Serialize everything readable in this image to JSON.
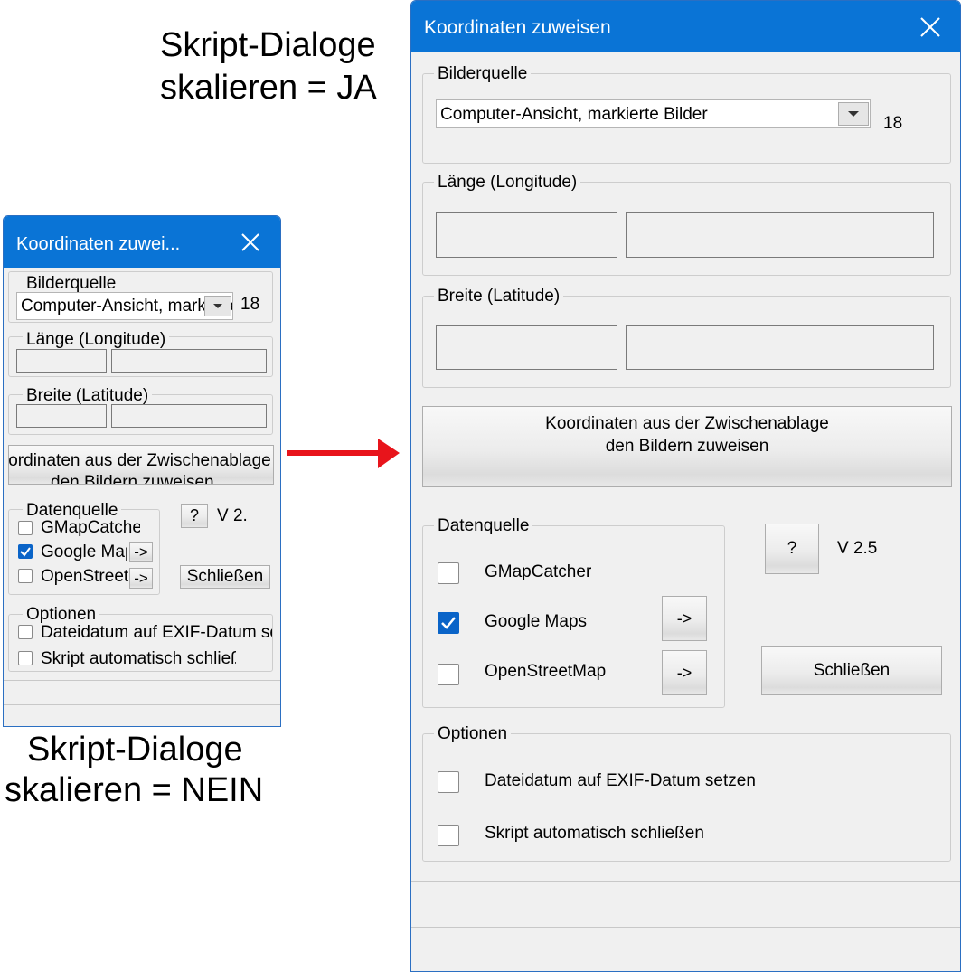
{
  "captions": {
    "yes_line1": "Skript-Dialoge",
    "yes_line2": "skalieren = JA",
    "no_line1": "Skript-Dialoge",
    "no_line2": "skalieren = NEIN"
  },
  "small_dialog": {
    "title": "Koordinaten zuwei...",
    "bilderquelle": {
      "legend": "Bilderquelle",
      "combo_value": "Computer-Ansicht, markierte Bilder",
      "count": "18"
    },
    "laenge": {
      "legend": "Länge (Longitude)"
    },
    "breite": {
      "legend": "Breite (Latitude)"
    },
    "assign_button": {
      "line1": "Koordinaten aus der Zwischenablage",
      "line2": "den Bildern zuweisen"
    },
    "datenquelle": {
      "legend": "Datenquelle",
      "items": [
        {
          "label": "GMapCatcher",
          "checked": false
        },
        {
          "label": "Google Maps",
          "checked": true,
          "arrow": "->"
        },
        {
          "label": "OpenStreetMap",
          "checked": false,
          "arrow": "->"
        }
      ]
    },
    "help_button": "?",
    "version": "V 2.",
    "close_button": "Schließen",
    "optionen": {
      "legend": "Optionen",
      "items": [
        {
          "label": "Dateidatum auf EXIF-Datum setzen",
          "checked": false
        },
        {
          "label": "Skript automatisch schließen",
          "checked": false
        }
      ]
    }
  },
  "large_dialog": {
    "title": "Koordinaten zuweisen",
    "bilderquelle": {
      "legend": "Bilderquelle",
      "combo_value": "Computer-Ansicht, markierte Bilder",
      "count": "18"
    },
    "laenge": {
      "legend": "Länge (Longitude)"
    },
    "breite": {
      "legend": "Breite (Latitude)"
    },
    "assign_button": {
      "line1": "Koordinaten aus der Zwischenablage",
      "line2": "den Bildern zuweisen"
    },
    "datenquelle": {
      "legend": "Datenquelle",
      "items": [
        {
          "label": "GMapCatcher",
          "checked": false
        },
        {
          "label": "Google Maps",
          "checked": true,
          "arrow": "->"
        },
        {
          "label": "OpenStreetMap",
          "checked": false,
          "arrow": "->"
        }
      ]
    },
    "help_button": "?",
    "version": "V 2.5",
    "close_button": "Schließen",
    "optionen": {
      "legend": "Optionen",
      "items": [
        {
          "label": "Dateidatum auf EXIF-Datum setzen",
          "checked": false
        },
        {
          "label": "Skript automatisch schließen",
          "checked": false
        }
      ]
    }
  },
  "colors": {
    "titlebar": "#0a74d6",
    "arrow": "#e8141b",
    "checkbox_checked": "#0a64c8"
  }
}
